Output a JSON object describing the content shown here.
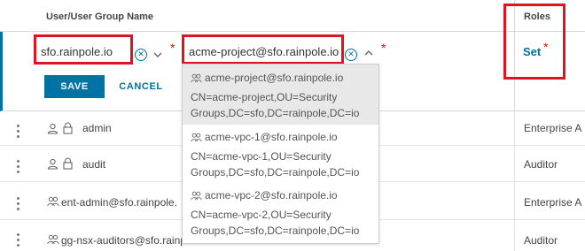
{
  "table": {
    "header_name": "User/User Group Name",
    "header_roles": "Roles"
  },
  "edit_row": {
    "domain_value": "sfo.rainpole.io",
    "search_value": "acme-project@sfo.rainpole.io",
    "required_mark": "*",
    "save_label": "SAVE",
    "cancel_label": "CANCEL",
    "roles_link": "Set",
    "roles_required": "*"
  },
  "rows": [
    {
      "name": "admin",
      "role": "Enterprise A",
      "icon": "user-lock-icon"
    },
    {
      "name": "audit",
      "role": "Auditor",
      "icon": "user-lock-icon"
    },
    {
      "name": "ent-admin@sfo.rainpole.",
      "role": "Enterprise A",
      "icon": "group-icon"
    },
    {
      "name": "gg-nsx-auditors@sfo.rainpole.io",
      "role": "Auditor",
      "icon": "group-icon"
    }
  ],
  "dropdown": {
    "options": [
      {
        "title": "acme-project@sfo.rainpole.io",
        "dn_line1": "CN=acme-project,OU=Security",
        "dn_line2": "Groups,DC=sfo,DC=rainpole,DC=io",
        "selected": true
      },
      {
        "title": "acme-vpc-1@sfo.rainpole.io",
        "dn_line1": "CN=acme-vpc-1,OU=Security",
        "dn_line2": "Groups,DC=sfo,DC=rainpole,DC=io",
        "selected": false
      },
      {
        "title": "acme-vpc-2@sfo.rainpole.io",
        "dn_line1": "CN=acme-vpc-2,OU=Security",
        "dn_line2": "Groups,DC=sfo,DC=rainpole,DC=io",
        "selected": false
      }
    ]
  },
  "colors": {
    "accent": "#0072a3",
    "required": "#c21d00",
    "highlight_box": "#e0141e"
  }
}
